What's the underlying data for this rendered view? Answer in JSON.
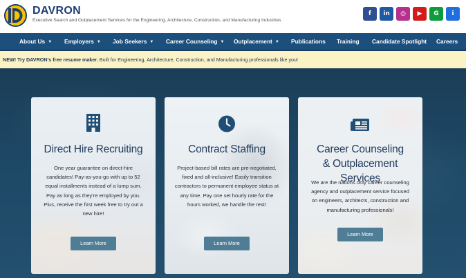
{
  "brand": {
    "name": "DAVRON",
    "tagline": "Executive Search and Outplacement Services for the Engineering, Architecture, Construction, and Manufacturing Industries"
  },
  "socials": [
    {
      "icon": "facebook-icon",
      "glyph": "f",
      "color": "#2f4f93"
    },
    {
      "icon": "linkedin-icon",
      "glyph": "in",
      "color": "#1e5aa3"
    },
    {
      "icon": "instagram-icon",
      "glyph": "◎",
      "color": "#b5318d"
    },
    {
      "icon": "youtube-icon",
      "glyph": "▶",
      "color": "#d31b1b"
    },
    {
      "icon": "glassdoor-icon",
      "glyph": "G",
      "color": "#0c9c3c"
    },
    {
      "icon": "info-icon",
      "glyph": "i",
      "color": "#1f6fe0"
    }
  ],
  "nav": {
    "items": [
      {
        "label": "About Us",
        "dropdown": true
      },
      {
        "label": "Employers",
        "dropdown": true
      },
      {
        "label": "Job Seekers",
        "dropdown": true
      },
      {
        "label": "Career Counseling",
        "dropdown": true
      },
      {
        "label": "Outplacement",
        "dropdown": true
      },
      {
        "label": "Publications",
        "dropdown": false
      },
      {
        "label": "Training",
        "dropdown": false
      },
      {
        "label": "Candidate Spotlight",
        "dropdown": false
      },
      {
        "label": "Careers",
        "dropdown": false
      }
    ]
  },
  "banner": {
    "lead": "NEW! Try DAVRON's free resume maker.",
    "rest": " Built for Engineering, Architecture, Construction, and Manufacturing professionals like you!"
  },
  "cards": [
    {
      "icon": "building-icon",
      "title": "Direct Hire Recruiting",
      "body": "One year guarantee on direct-hire candidates! Pay-as-you-go with up to 52 equal installments instead of a lump sum. Pay as long as they're employed by you. Plus, receive the first week free to try out a new hire!",
      "button": "Learn More"
    },
    {
      "icon": "clock-icon",
      "title": "Contract Staffing",
      "body": "Project-based bill rates are pre-negotiated, fixed and all-inclusive! Easily transition contractors to permanent employee status at any time. Pay one set hourly rate for the hours worked, we handle the rest!",
      "button": "Learn More"
    },
    {
      "icon": "newspaper-icon",
      "title": "Career Counseling & Outplacement Services",
      "body": "We are the nations only career counseling agency and outplacement service focused on engineers, architects, construction and manufacturing professionals!",
      "button": "Learn More"
    }
  ],
  "colors": {
    "nav_bg": "#1c4f7c",
    "banner_bg": "#fbf3c6",
    "hero_bg": "#1e4a68",
    "button_bg": "#4f7d95",
    "title_color": "#1f3a5c"
  }
}
